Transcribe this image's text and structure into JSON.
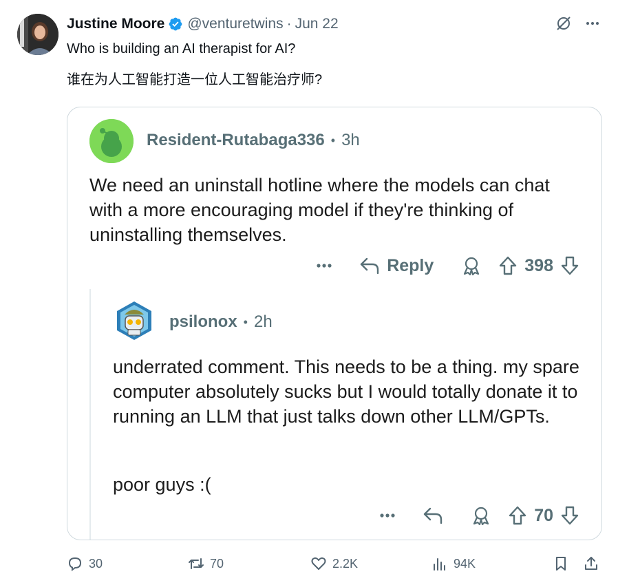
{
  "tweet": {
    "author_name": "Justine Moore",
    "handle": "@venturetwins",
    "separator": "·",
    "date": "Jun 22",
    "text_en": "Who is building an AI therapist for AI?",
    "text_zh": "谁在为人工智能打造一位人工智能治疗师?"
  },
  "embedded": {
    "comment1": {
      "username": "Resident-Rutabaga336",
      "bullet": "•",
      "time": "3h",
      "body": "We need an uninstall hotline where the models can chat with a more encouraging model if they're thinking of uninstalling themselves.",
      "reply_label": "Reply",
      "votes": "398"
    },
    "comment2": {
      "username": "psilonox",
      "bullet": "•",
      "time": "2h",
      "body": "underrated comment. This needs to be a thing. my spare computer absolutely sucks but I would totally donate it to running an LLM that just talks down other LLM/GPTs.",
      "body2": "poor guys :(",
      "votes": "70"
    }
  },
  "footer": {
    "replies": "30",
    "reposts": "70",
    "likes": "2.2K",
    "views": "94K"
  },
  "colors": {
    "verified": "#1d9bf0",
    "reddit_green": "#7ed957",
    "muted": "#536471"
  }
}
